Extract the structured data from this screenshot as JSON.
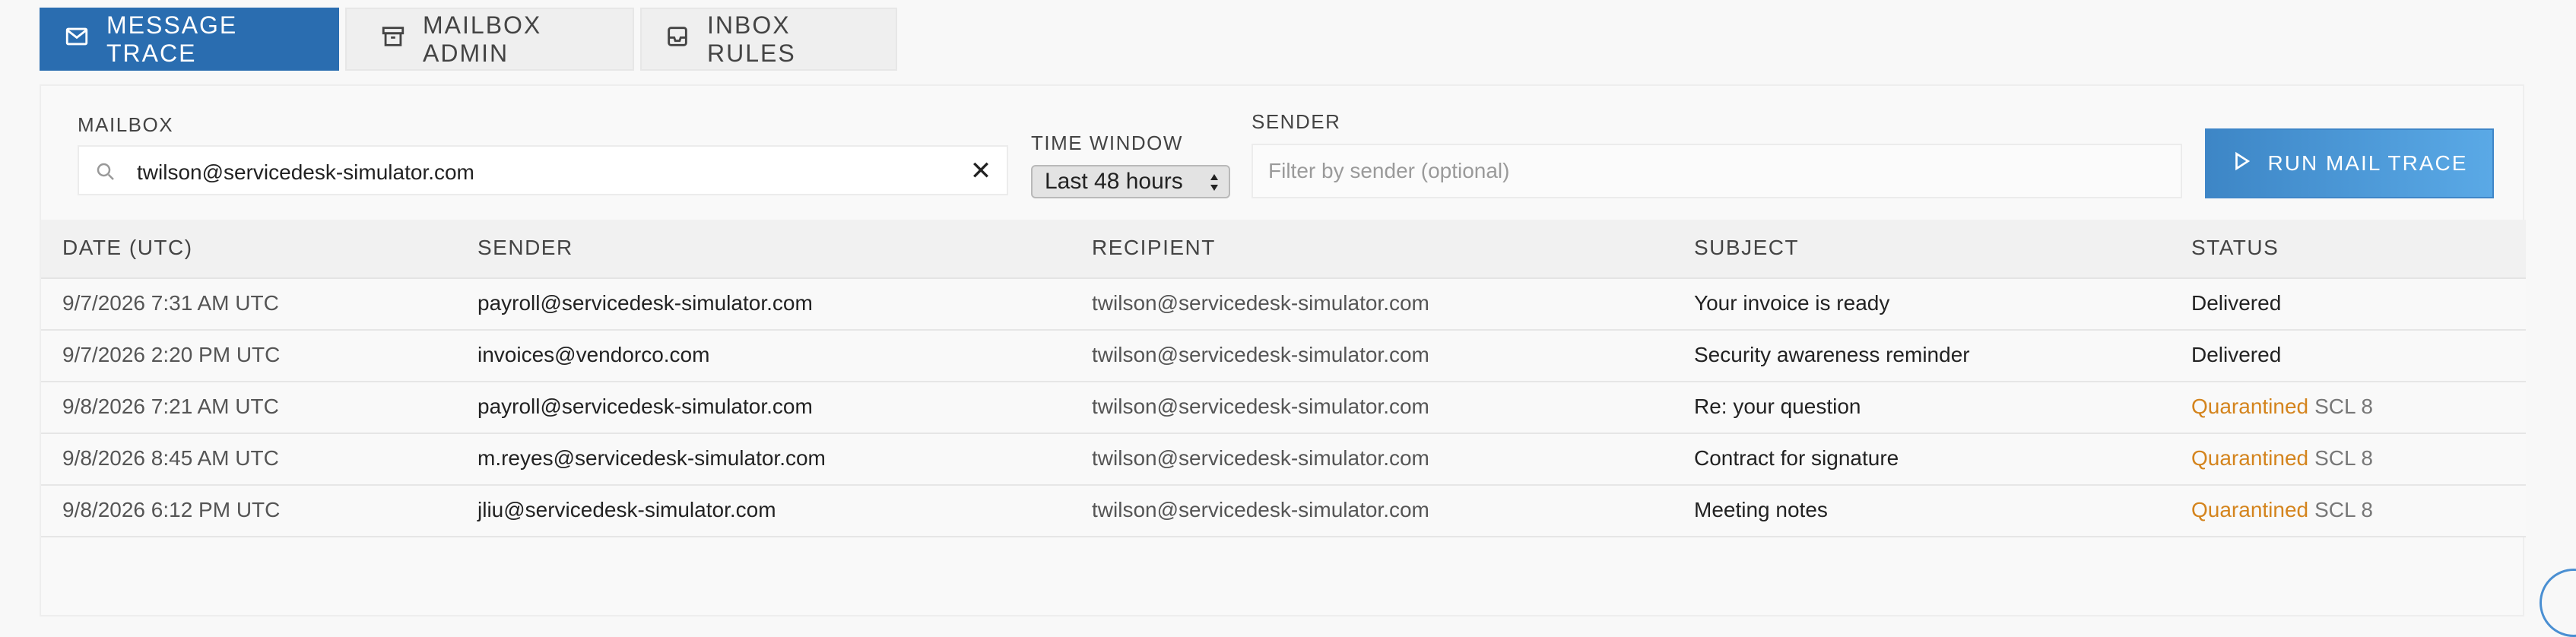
{
  "tabs": [
    {
      "label": "MESSAGE TRACE",
      "icon": "envelope-icon",
      "active": true
    },
    {
      "label": "MAILBOX ADMIN",
      "icon": "archive-box-icon",
      "active": false
    },
    {
      "label": "INBOX RULES",
      "icon": "inbox-icon",
      "active": false
    }
  ],
  "filters": {
    "mailbox_label": "MAILBOX",
    "mailbox_value": "twilson@servicedesk-simulator.com",
    "time_window_label": "TIME WINDOW",
    "time_window_value": "Last 48 hours",
    "sender_label": "SENDER",
    "sender_placeholder": "Filter by sender (optional)",
    "run_button": "RUN MAIL TRACE"
  },
  "table": {
    "headers": [
      "DATE (UTC)",
      "SENDER",
      "RECIPIENT",
      "SUBJECT",
      "STATUS"
    ],
    "rows": [
      {
        "date": "9/7/2026 7:31 AM UTC",
        "sender": "payroll@servicedesk-simulator.com",
        "recipient": "twilson@servicedesk-simulator.com",
        "subject": "Your invoice is ready",
        "status": "Delivered",
        "scl": ""
      },
      {
        "date": "9/7/2026 2:20 PM UTC",
        "sender": "invoices@vendorco.com",
        "recipient": "twilson@servicedesk-simulator.com",
        "subject": "Security awareness reminder",
        "status": "Delivered",
        "scl": ""
      },
      {
        "date": "9/8/2026 7:21 AM UTC",
        "sender": "payroll@servicedesk-simulator.com",
        "recipient": "twilson@servicedesk-simulator.com",
        "subject": "Re: your question",
        "status": "Quarantined",
        "scl": "SCL 8"
      },
      {
        "date": "9/8/2026 8:45 AM UTC",
        "sender": "m.reyes@servicedesk-simulator.com",
        "recipient": "twilson@servicedesk-simulator.com",
        "subject": "Contract for signature",
        "status": "Quarantined",
        "scl": "SCL 8"
      },
      {
        "date": "9/8/2026 6:12 PM UTC",
        "sender": "jliu@servicedesk-simulator.com",
        "recipient": "twilson@servicedesk-simulator.com",
        "subject": "Meeting notes",
        "status": "Quarantined",
        "scl": "SCL 8"
      }
    ]
  },
  "colors": {
    "tab_active": "#2a6db0",
    "run_button": "#4a95d6",
    "quarantined": "#d4841d"
  }
}
